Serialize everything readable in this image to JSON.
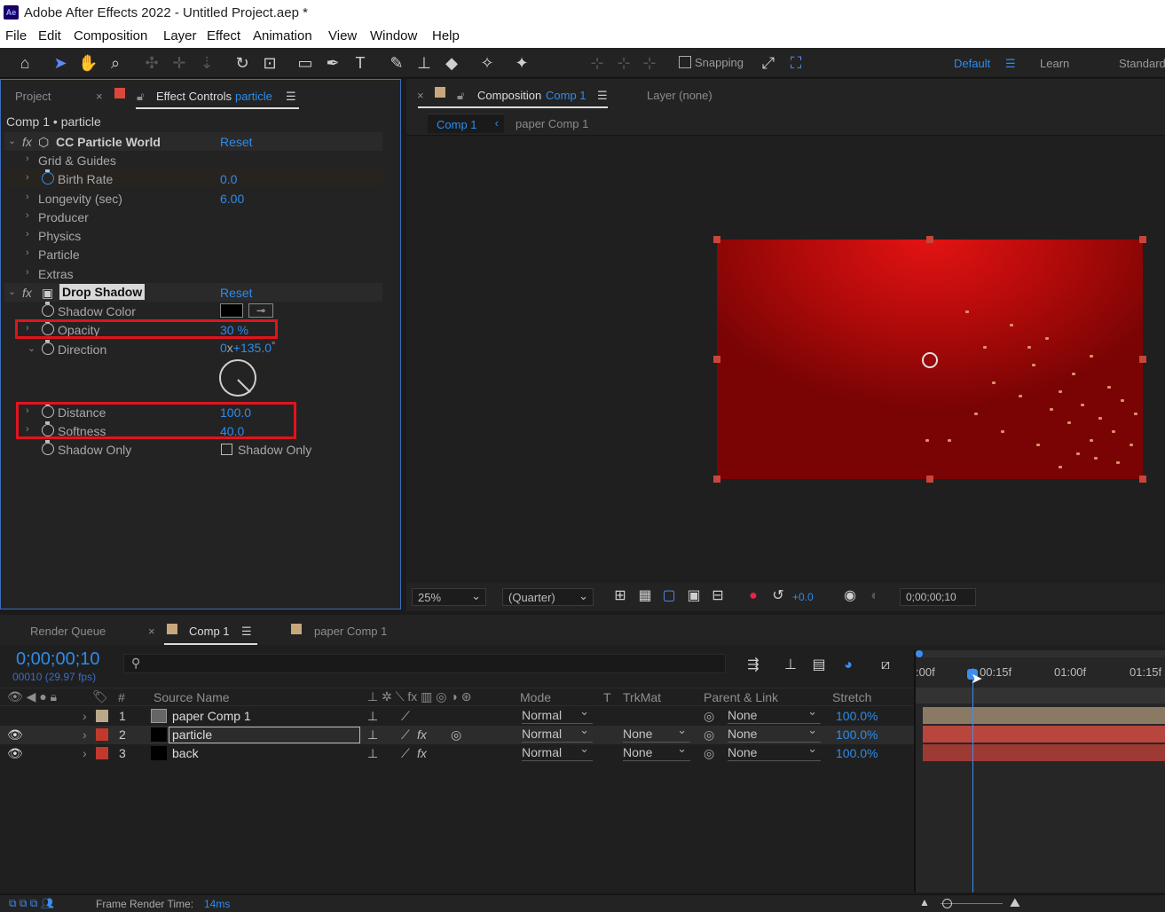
{
  "window": {
    "title": "Adobe After Effects 2022 - Untitled Project.aep *",
    "logo": "Ae"
  },
  "menu": [
    "File",
    "Edit",
    "Composition",
    "Layer",
    "Effect",
    "Animation",
    "View",
    "Window",
    "Help"
  ],
  "toolbar": {
    "snapping": "Snapping",
    "workspaces": [
      "Default",
      "Learn",
      "Standard"
    ]
  },
  "left_panel": {
    "tabs": {
      "project": "Project",
      "effect_controls": "Effect Controls",
      "effect_controls_layer": "particle"
    },
    "breadcrumb": "Comp 1 • particle",
    "effects": [
      {
        "name": "CC Particle World",
        "reset": "Reset",
        "props": [
          {
            "label": "Grid & Guides"
          },
          {
            "label": "Birth Rate",
            "value": "0.0"
          },
          {
            "label": "Longevity (sec)",
            "value": "6.00"
          },
          {
            "label": "Producer"
          },
          {
            "label": "Physics"
          },
          {
            "label": "Particle"
          },
          {
            "label": "Extras"
          }
        ]
      },
      {
        "name": "Drop Shadow",
        "reset": "Reset",
        "props": [
          {
            "label": "Shadow Color"
          },
          {
            "label": "Opacity",
            "value": "30 %"
          },
          {
            "label": "Direction",
            "value_prefix": "0",
            "value_x": "x",
            "value": "+135.0",
            "unit": "°"
          },
          {
            "label": "Distance",
            "value": "100.0"
          },
          {
            "label": "Softness",
            "value": "40.0"
          },
          {
            "label": "Shadow Only",
            "checkbox_label": "Shadow Only"
          }
        ]
      }
    ]
  },
  "composition_panel": {
    "tab_label": "Composition",
    "tab_comp": "Comp 1",
    "layer_tab": "Layer (none)",
    "subtabs": [
      "Comp 1",
      "paper Comp 1"
    ],
    "zoom": "25%",
    "resolution": "(Quarter)",
    "exposure": "+0.0",
    "timecode": "0;00;00;10"
  },
  "timeline": {
    "tabs": [
      "Render Queue",
      "Comp 1",
      "paper Comp 1"
    ],
    "timecode": "0;00;00;10",
    "frames": "00010 (29.97 fps)",
    "columns": {
      "hash": "#",
      "source_name": "Source Name",
      "mode": "Mode",
      "t": "T",
      "trkmat": "TrkMat",
      "parent": "Parent & Link",
      "stretch": "Stretch"
    },
    "ruler": [
      ":00f",
      "00:15f",
      "01:00f",
      "01:15f"
    ],
    "layers": [
      {
        "num": "1",
        "name": "paper Comp 1",
        "mode": "Normal",
        "trkmat": "",
        "parent": "None",
        "stretch": "100.0%",
        "color": "#b9a88a",
        "eye": false
      },
      {
        "num": "2",
        "name": "particle",
        "mode": "Normal",
        "trkmat": "None",
        "parent": "None",
        "stretch": "100.0%",
        "color": "#c0392b",
        "eye": true
      },
      {
        "num": "3",
        "name": "back",
        "mode": "Normal",
        "trkmat": "None",
        "parent": "None",
        "stretch": "100.0%",
        "color": "#c0392b",
        "eye": true
      }
    ],
    "status": {
      "label": "Frame Render Time:",
      "value": "14ms"
    }
  },
  "colors": {
    "accent": "#2d8ceb",
    "highlight": "#e0141e",
    "comp_bg": "#b50c0c"
  }
}
